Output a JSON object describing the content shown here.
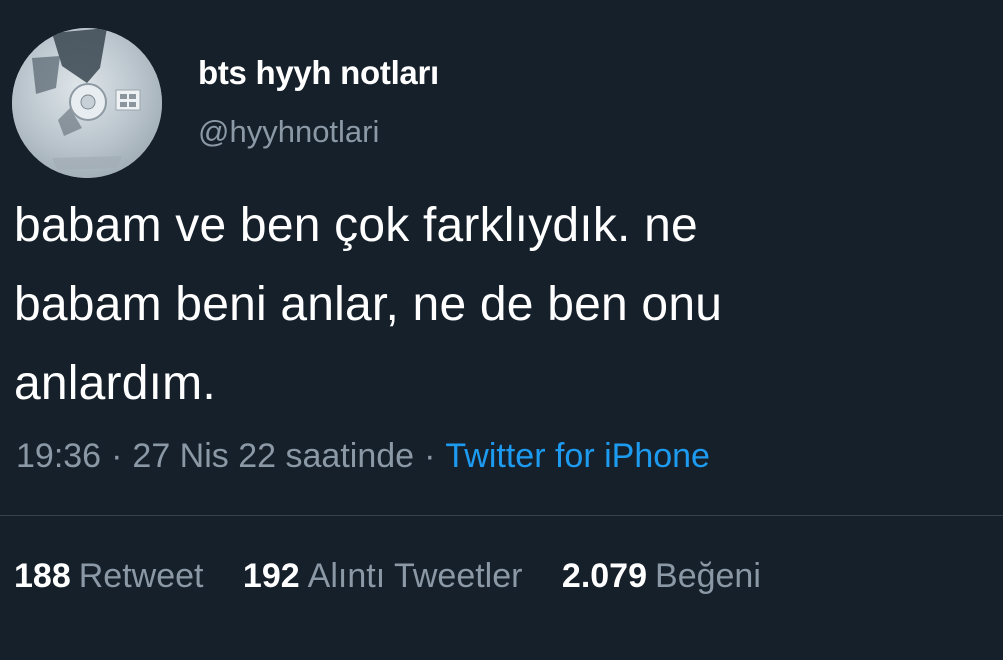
{
  "author": {
    "display_name": "bts hyyh notları",
    "handle": "@hyyhnotlari",
    "avatar": "cd-disc-avatar"
  },
  "tweet": {
    "lines": [
      "babam ve ben çok farklıydık. ne",
      "babam beni anlar, ne de ben onu",
      "anlardım."
    ],
    "time": "19:36",
    "separator": "·",
    "date": "27 Nis 22 saatinde",
    "source": "Twitter for iPhone"
  },
  "stats": {
    "retweets": {
      "count": "188",
      "label": "Retweet"
    },
    "quotes": {
      "count": "192",
      "label": "Alıntı Tweetler"
    },
    "likes": {
      "count": "2.079",
      "label": "Beğeni"
    }
  },
  "colors": {
    "background": "#15202b",
    "text": "#ffffff",
    "secondary": "#8b98a5",
    "link": "#1d9bf0",
    "divider": "#38444d"
  }
}
